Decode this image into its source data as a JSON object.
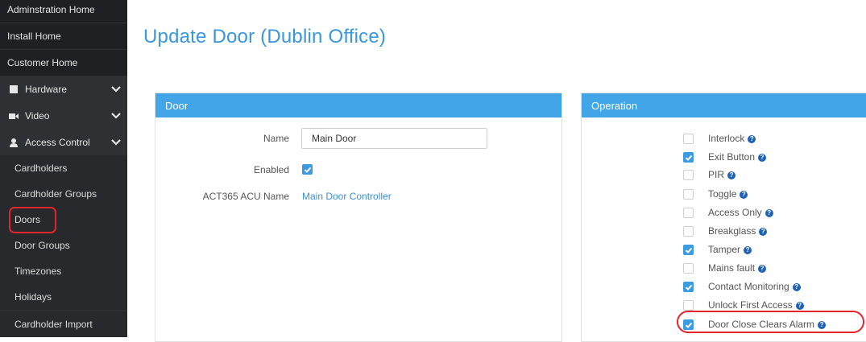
{
  "sidebar": {
    "top_items": [
      {
        "label": "Adminstration Home"
      },
      {
        "label": "Install Home"
      },
      {
        "label": "Customer Home"
      }
    ],
    "sections": [
      {
        "label": "Hardware",
        "icon": "hardware-icon"
      },
      {
        "label": "Video",
        "icon": "video-icon"
      },
      {
        "label": "Access Control",
        "icon": "user-icon"
      }
    ],
    "sub_items": [
      {
        "label": "Cardholders"
      },
      {
        "label": "Cardholder Groups"
      },
      {
        "label": "Doors",
        "selected": true
      },
      {
        "label": "Door Groups"
      },
      {
        "label": "Timezones"
      },
      {
        "label": "Holidays"
      },
      {
        "label": "Cardholder Import"
      }
    ]
  },
  "page": {
    "title": "Update Door (Dublin Office)"
  },
  "door_panel": {
    "header": "Door",
    "name_label": "Name",
    "name_value": "Main Door",
    "enabled_label": "Enabled",
    "enabled": true,
    "acu_label": "ACT365 ACU Name",
    "acu_value": "Main Door Controller"
  },
  "operation_panel": {
    "header": "Operation",
    "options": [
      {
        "label": "Interlock",
        "checked": false
      },
      {
        "label": "Exit Button",
        "checked": true
      },
      {
        "label": "PIR",
        "checked": false
      },
      {
        "label": "Toggle",
        "checked": false
      },
      {
        "label": "Access Only",
        "checked": false
      },
      {
        "label": "Breakglass",
        "checked": false
      },
      {
        "label": "Tamper",
        "checked": true
      },
      {
        "label": "Mains fault",
        "checked": false
      },
      {
        "label": "Contact Monitoring",
        "checked": true
      },
      {
        "label": "Unlock First Access",
        "checked": false
      },
      {
        "label": "Door Close Clears Alarm",
        "checked": true
      }
    ],
    "help_glyph": "?"
  },
  "colors": {
    "accent": "#3a96dd",
    "panel_header": "#42a5e8",
    "sidebar_bg": "#2f3033",
    "highlight": "#e3262b"
  }
}
